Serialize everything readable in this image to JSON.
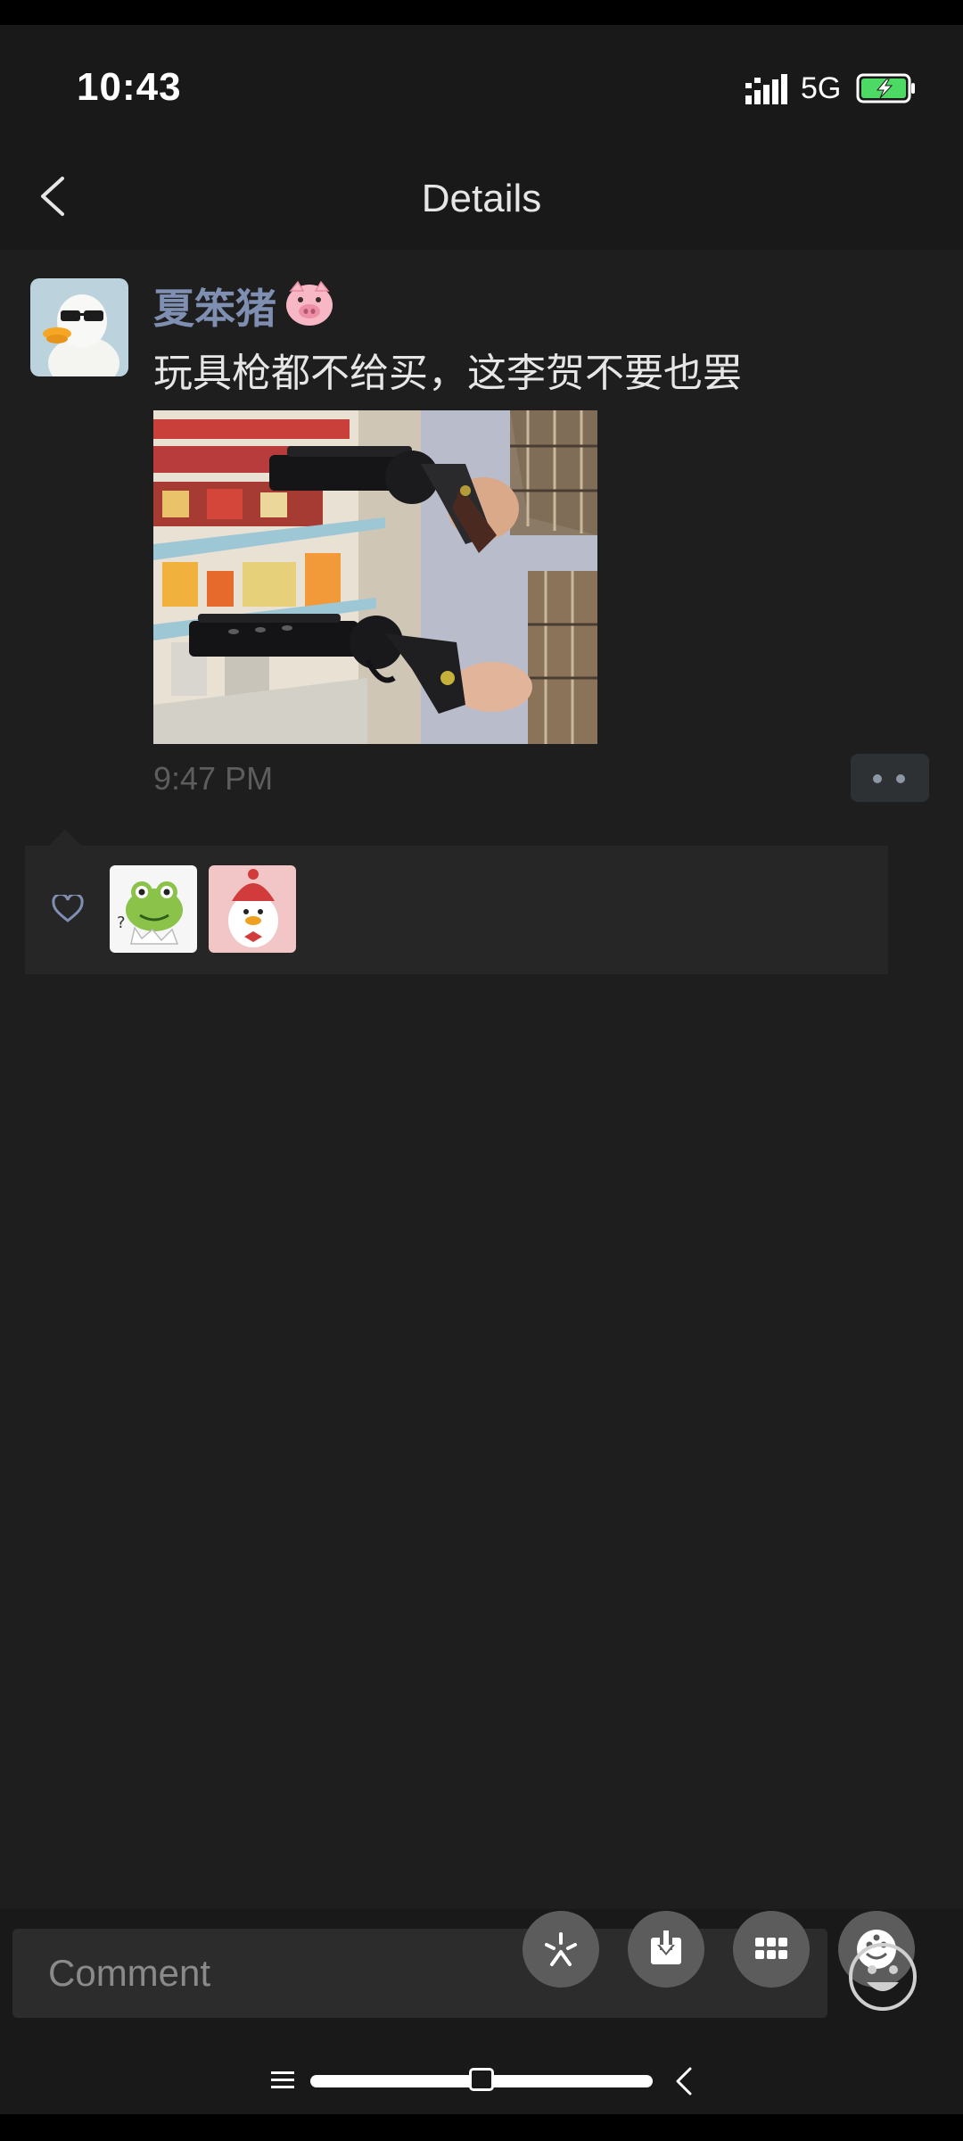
{
  "status_bar": {
    "time": "10:43",
    "network": "5G",
    "signal_icon": "signal-bars-icon",
    "battery_icon": "battery-charging-icon"
  },
  "nav": {
    "title": "Details",
    "back_icon": "chevron-left-icon"
  },
  "post": {
    "username": "夏笨猪",
    "username_emoji": "pig-face-emoji",
    "text": "玩具枪都不给买，这李贺不要也罢",
    "photo_description_icon": "photo-two-revolvers",
    "time": "9:47 PM",
    "more_icon": "more-dots-icon"
  },
  "likes": {
    "heart_icon": "heart-outline-icon",
    "users": [
      {
        "avatar": "frog-avatar"
      },
      {
        "avatar": "red-hat-duck-avatar"
      }
    ]
  },
  "comment": {
    "placeholder": "Comment",
    "emoji_icon": "smiley-face-icon"
  },
  "floating_actions": [
    {
      "icon": "sparkle-burst-icon"
    },
    {
      "icon": "download-icon"
    },
    {
      "icon": "grid-apps-icon"
    },
    {
      "icon": "emoji-circle-icon"
    }
  ],
  "colors": {
    "background": "#191919",
    "username": "#7f8fb2",
    "text": "#e6e6e6",
    "muted": "#5d5d5d",
    "likes_bg": "#262626",
    "battery_green": "#4cd964"
  }
}
